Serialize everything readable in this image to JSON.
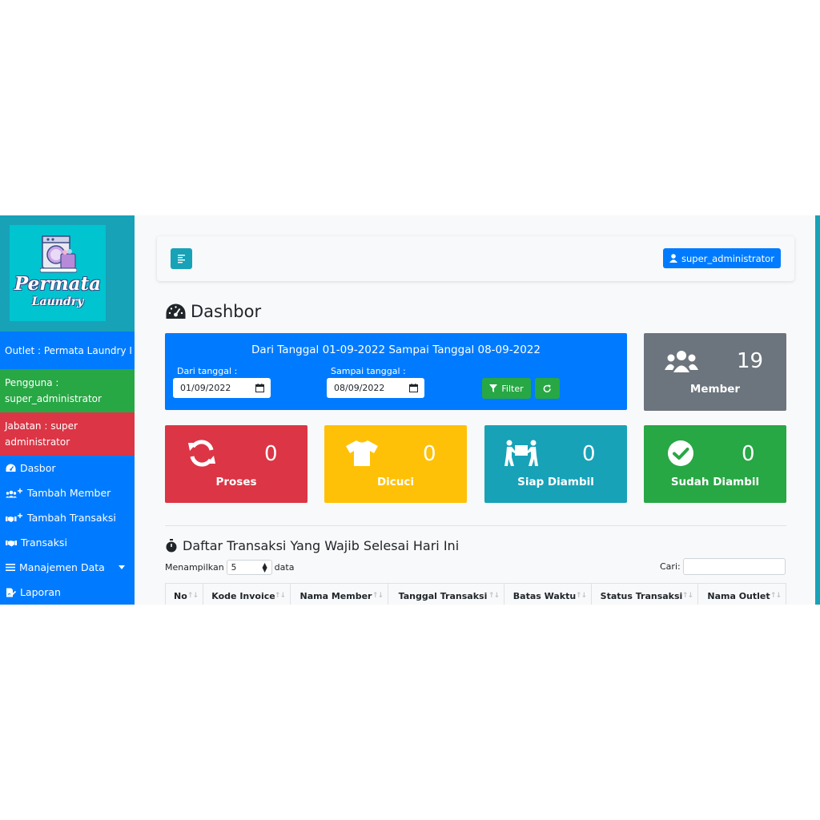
{
  "brand": {
    "title": "Permata",
    "subtitle": "Laundry"
  },
  "sidebar": {
    "outlet": "Outlet : Permata Laundry I",
    "user": "Pengguna : super_administrator",
    "role": "Jabatan : super administrator",
    "items": [
      {
        "label": "Dasbor",
        "icon": "tachometer-icon"
      },
      {
        "label": "Tambah Member",
        "icon": "user-plus-icon"
      },
      {
        "label": "Tambah Transaksi",
        "icon": "handshake-plus-icon"
      },
      {
        "label": "Transaksi",
        "icon": "handshake-icon"
      },
      {
        "label": "Manajemen Data",
        "icon": "bars-icon"
      },
      {
        "label": "Laporan",
        "icon": "file-signature-icon"
      }
    ]
  },
  "header": {
    "user_button": "super_administrator"
  },
  "page": {
    "title": "Dashbor"
  },
  "filter": {
    "heading": "Dari Tanggal 01-09-2022 Sampai Tanggal 08-09-2022",
    "from_label": "Dari tanggal :",
    "from_value": "01/09/2022",
    "to_label": "Sampai tanggal :",
    "to_value": "08/09/2022",
    "filter_button": "Filter"
  },
  "stats": {
    "member": {
      "label": "Member",
      "value": "19",
      "color": "#6c757d"
    },
    "proses": {
      "label": "Proses",
      "value": "0",
      "color": "#dc3545"
    },
    "dicuci": {
      "label": "Dicuci",
      "value": "0",
      "color": "#ffc107"
    },
    "siap": {
      "label": "Siap Diambil",
      "value": "0",
      "color": "#17a2b8"
    },
    "sudah": {
      "label": "Sudah Diambil",
      "value": "0",
      "color": "#28a745"
    }
  },
  "list": {
    "title": "Daftar Transaksi Yang Wajib Selesai Hari Ini",
    "show_prefix": "Menampilkan",
    "show_value": "5",
    "show_suffix": "data",
    "search_label": "Cari:",
    "columns": [
      "No",
      "Kode Invoice",
      "Nama Member",
      "Tanggal Transaksi",
      "Batas Waktu",
      "Status Transaksi",
      "Nama Outlet"
    ]
  }
}
